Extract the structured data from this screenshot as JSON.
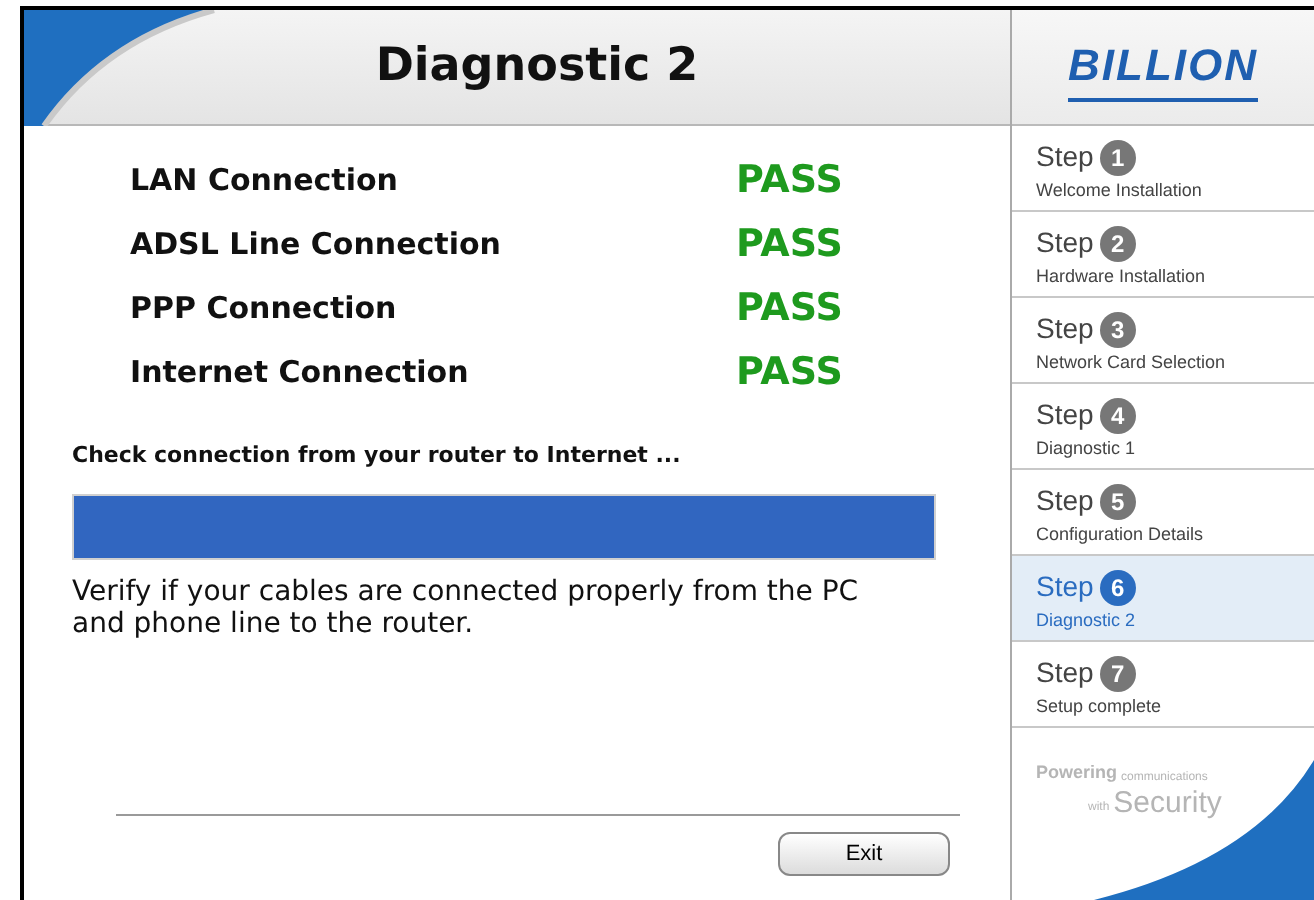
{
  "header": {
    "title": "Diagnostic 2"
  },
  "logo": {
    "text": "BILLION"
  },
  "checks": [
    {
      "label": "LAN Connection",
      "result": "PASS"
    },
    {
      "label": "ADSL Line Connection",
      "result": "PASS"
    },
    {
      "label": "PPP Connection",
      "result": "PASS"
    },
    {
      "label": "Internet Connection",
      "result": "PASS"
    }
  ],
  "status": {
    "text": "Check connection from your router to Internet ...",
    "level": 1
  },
  "message": "Verify if your cables are connected properly from the PC and phone line to the router.",
  "buttons": [
    "Exit"
  ],
  "steps": [
    {
      "label": "Step",
      "number": "1",
      "description": "Welcome Installation",
      "selected": false
    },
    {
      "label": "Step",
      "number": "2",
      "description": "Hardware Installation",
      "selected": false
    },
    {
      "label": "Step",
      "number": "3",
      "description": "Network Card Selection",
      "selected": false
    },
    {
      "label": "Step",
      "number": "4",
      "description": "Diagnostic 1",
      "selected": false
    },
    {
      "label": "Step",
      "number": "5",
      "description": "Configuration Details",
      "selected": false
    },
    {
      "label": "Step",
      "number": "6",
      "description": "Diagnostic 2",
      "selected": true
    },
    {
      "label": "Step",
      "number": "7",
      "description": "Setup complete",
      "selected": false
    }
  ],
  "tagline": {
    "small": "Powering",
    "tiny": "communications",
    "with": "with",
    "big": "Security"
  }
}
